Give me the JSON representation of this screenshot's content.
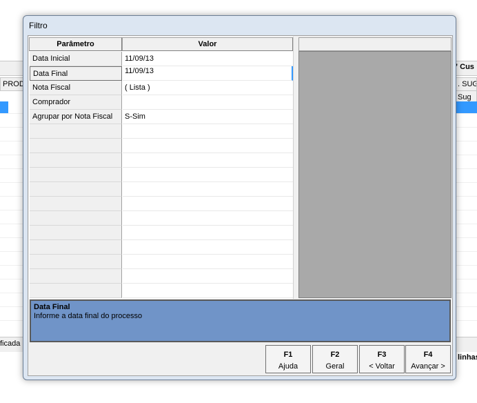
{
  "background": {
    "header_right": "Cus",
    "col_prod": "PROD",
    "col_sug_top": "SUG",
    "col_sug": "Sug",
    "status_left": "ficada",
    "status_right": "linhas"
  },
  "dialog": {
    "title": "Filtro",
    "columns": {
      "param": "Parâmetro",
      "value": "Valor"
    },
    "rows": [
      {
        "param": "Data Inicial",
        "value": "11/09/13"
      },
      {
        "param": "Data Final",
        "value": "11/09/13"
      },
      {
        "param": "Nota Fiscal",
        "value": "( Lista )"
      },
      {
        "param": "Comprador",
        "value": ""
      },
      {
        "param": "Agrupar por Nota Fiscal",
        "value": "S-Sim"
      }
    ],
    "help": {
      "title": "Data Final",
      "text": "Informe a data final do processo"
    },
    "buttons": [
      {
        "key": "F1",
        "label": "Ajuda"
      },
      {
        "key": "F2",
        "label": "Geral"
      },
      {
        "key": "F3",
        "label": "< Voltar"
      },
      {
        "key": "F4",
        "label": "Avançar >"
      }
    ]
  }
}
